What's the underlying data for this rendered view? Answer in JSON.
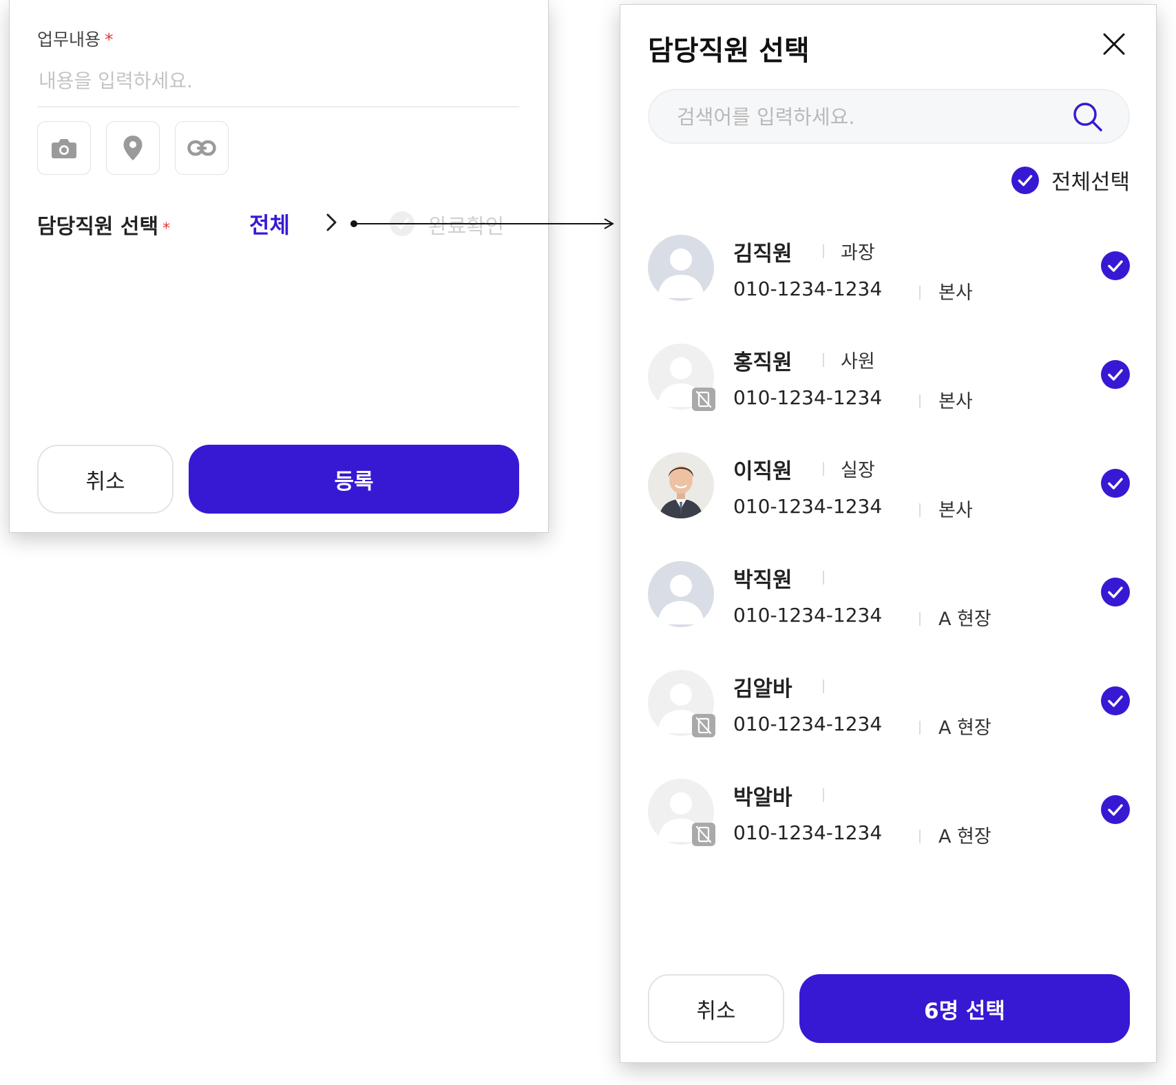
{
  "form": {
    "content_label": "업무내용",
    "required_mark": "*",
    "content_placeholder": "내용을 입력하세요.",
    "attachments": [
      {
        "icon": "camera-icon"
      },
      {
        "icon": "location-pin-icon"
      },
      {
        "icon": "link-icon"
      }
    ],
    "assignee_label": "담당직원 선택",
    "assignee_value": "전체",
    "done_label": "완료확인",
    "cancel_label": "취소",
    "submit_label": "등록"
  },
  "modal": {
    "title": "담당직원 선택",
    "search_placeholder": "검색어를 입력하세요.",
    "select_all_label": "전체선택",
    "select_all_checked": true,
    "employees": [
      {
        "name": "김직원",
        "title": "과장",
        "phone": "010-1234-1234",
        "dept": "본사",
        "avatar": "default",
        "no_device": false,
        "selected": true
      },
      {
        "name": "홍직원",
        "title": "사원",
        "phone": "010-1234-1234",
        "dept": "본사",
        "avatar": "faded",
        "no_device": true,
        "selected": true
      },
      {
        "name": "이직원",
        "title": "실장",
        "phone": "010-1234-1234",
        "dept": "본사",
        "avatar": "photo",
        "no_device": false,
        "selected": true
      },
      {
        "name": "박직원",
        "title": "",
        "phone": "010-1234-1234",
        "dept": "A 현장",
        "avatar": "default",
        "no_device": false,
        "selected": true
      },
      {
        "name": "김알바",
        "title": "",
        "phone": "010-1234-1234",
        "dept": "A 현장",
        "avatar": "faded",
        "no_device": true,
        "selected": true
      },
      {
        "name": "박알바",
        "title": "",
        "phone": "010-1234-1234",
        "dept": "A 현장",
        "avatar": "faded",
        "no_device": true,
        "selected": true
      }
    ],
    "cancel_label": "취소",
    "confirm_label": "6명 선택"
  },
  "colors": {
    "primary": "#3819d3",
    "required": "#e53935",
    "avatar_default": "#d9dde6",
    "avatar_faded": "#f0f0f0"
  }
}
